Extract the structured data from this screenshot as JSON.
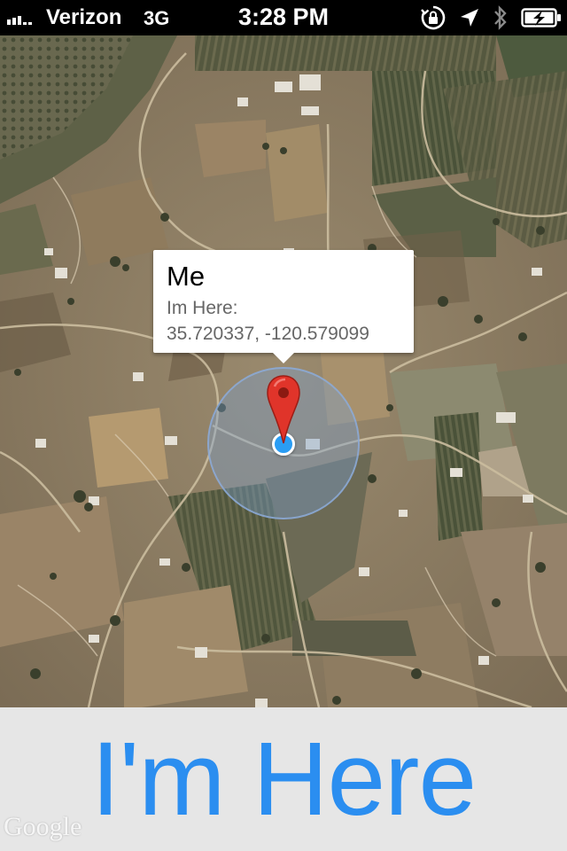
{
  "status_bar": {
    "carrier": "Verizon",
    "network": "3G",
    "time": "3:28 PM",
    "icons": [
      "signal-icon",
      "orientation-lock-icon",
      "location-services-icon",
      "bluetooth-icon",
      "battery-charging-icon"
    ],
    "signal_bars_filled": 3,
    "signal_bars_total": 5
  },
  "map": {
    "type": "satellite",
    "annotation": {
      "title": "Me",
      "subtitle": "Im Here:",
      "coordinates": "35.720337, -120.579099"
    },
    "pin_color": "#e0342a",
    "user_location_color": "#2a9df4",
    "accuracy_circle_color": "#7aa0d2",
    "attribution": "Google"
  },
  "bottom_bar": {
    "button_label": "I'm Here",
    "button_color": "#2b8ef0"
  }
}
